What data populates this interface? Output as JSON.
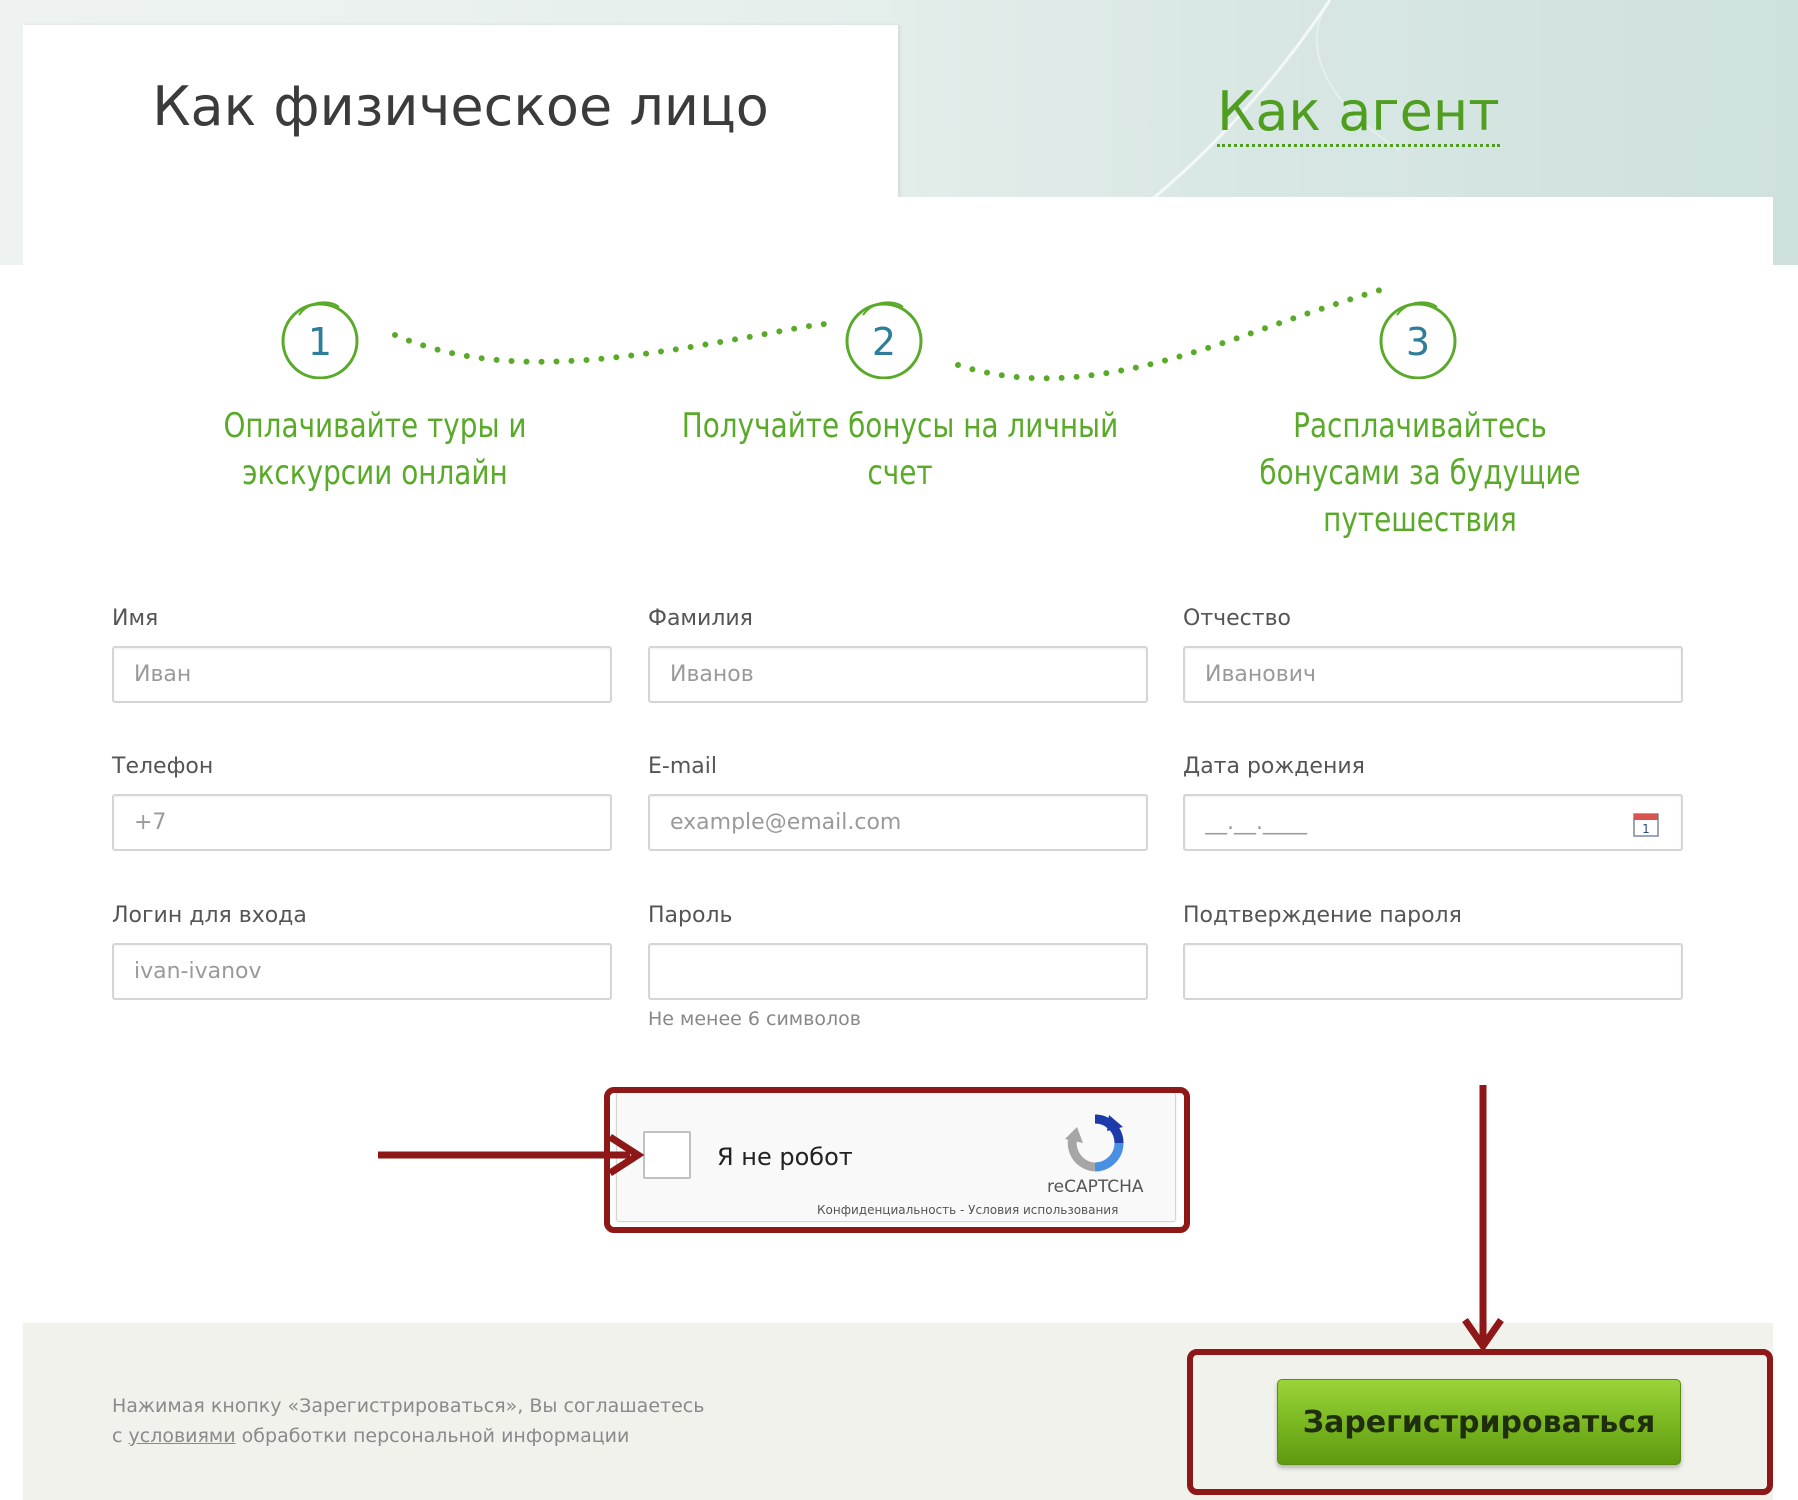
{
  "tabs": {
    "individual": "Как физическое лицо",
    "agent": "Как агент"
  },
  "steps": [
    {
      "number": "1",
      "text": "Оплачивайте туры и экскурсии онлайн"
    },
    {
      "number": "2",
      "text": "Получайте бонусы на личный счет"
    },
    {
      "number": "3",
      "text": "Расплачивайтесь бонусами за будущие путешествия"
    }
  ],
  "form": {
    "first_name": {
      "label": "Имя",
      "placeholder": "Иван"
    },
    "last_name": {
      "label": "Фамилия",
      "placeholder": "Иванов"
    },
    "middle_name": {
      "label": "Отчество",
      "placeholder": "Иванович"
    },
    "phone": {
      "label": "Телефон",
      "placeholder": "+7"
    },
    "email": {
      "label": "E-mail",
      "placeholder": "example@email.com"
    },
    "birthdate": {
      "label": "Дата рождения",
      "placeholder": "__.__.____"
    },
    "login": {
      "label": "Логин для входа",
      "placeholder": "ivan-ivanov"
    },
    "password": {
      "label": "Пароль",
      "placeholder": "",
      "hint": "Не менее 6 символов"
    },
    "password_confirm": {
      "label": "Подтверждение пароля",
      "placeholder": ""
    }
  },
  "captcha": {
    "label": "Я не робот",
    "brand": "reCAPTCHA",
    "links": "Конфиденциальность - Условия использования"
  },
  "footer": {
    "line1": "Нажимая кнопку «Зарегистрироваться», Вы соглашаетесь",
    "line2_prefix": "с ",
    "line2_link": "условиями",
    "line2_suffix": " обработки персональной информации"
  },
  "register_button": "Зарегистрироваться",
  "colors": {
    "accent_green": "#4f9e1f",
    "step_green": "#5aaa2a",
    "highlight_red": "#8e1717",
    "button_green": "#78b51f"
  }
}
